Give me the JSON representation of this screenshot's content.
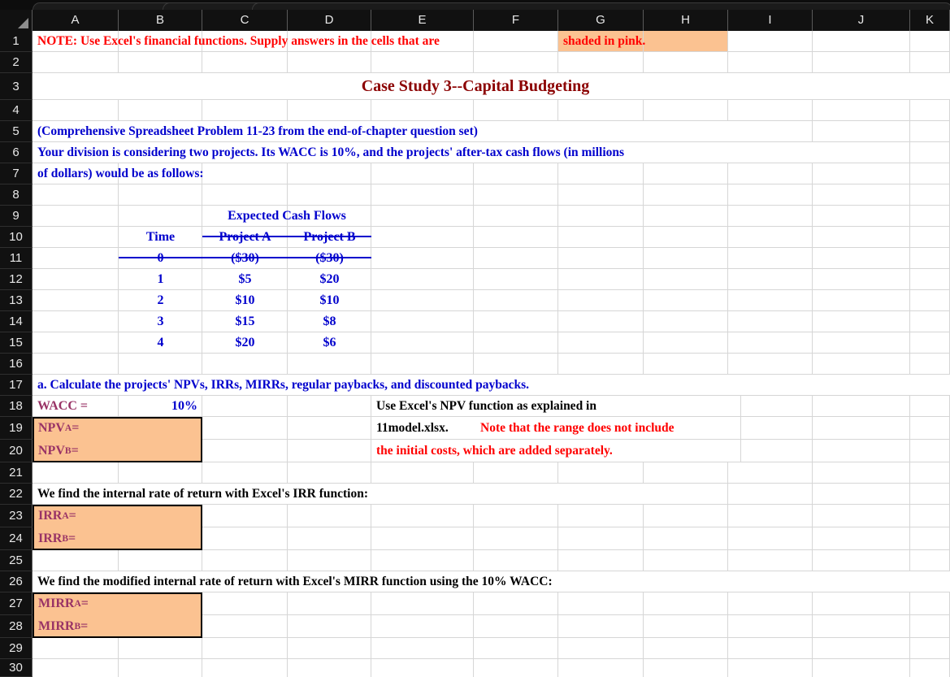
{
  "window": {
    "tabs": [
      "tab-1",
      "tab-2",
      "tab-3"
    ]
  },
  "spreadsheet": {
    "column_headers": [
      "A",
      "B",
      "C",
      "D",
      "E",
      "F",
      "G",
      "H",
      "I",
      "J",
      "K"
    ],
    "row_numbers": [
      "1",
      "2",
      "3",
      "4",
      "5",
      "6",
      "7",
      "8",
      "9",
      "10",
      "11",
      "12",
      "13",
      "14",
      "15",
      "16",
      "17",
      "18",
      "19",
      "20",
      "21",
      "22",
      "23",
      "24",
      "25",
      "26",
      "27",
      "28",
      "29",
      "30"
    ],
    "colors": {
      "note_text": "#ff0000",
      "title_text": "#8b0000",
      "body_text": "#0000cd",
      "label_text": "#993366",
      "pink_fill": "#fbc291",
      "header_bg": "#111111",
      "gridline": "#d6d6d6"
    },
    "cells": {
      "note": "NOTE:  Use Excel's financial functions.  Supply answers in the cells that are ",
      "note_highlight": "shaded in pink.",
      "title": "Case Study 3--Capital Budgeting",
      "intro_line1": "(Comprehensive Spreadsheet Problem 11-23 from the end-of-chapter question set)",
      "intro_line2": "Your division is considering two projects.  Its WACC is 10%, and the projects' after-tax cash flows (in millions",
      "intro_line3": "of dollars) would be as follows:",
      "cashflow_header": "Expected Cash Flows",
      "col_time": "Time",
      "col_project_a": "Project A",
      "col_project_b": "Project B",
      "question_a": "a.   Calculate the projects' NPVs, IRRs, MIRRs, regular paybacks, and discounted paybacks.",
      "wacc_label": "WACC  =",
      "wacc_value": "10%",
      "npv_a_label": "NPV",
      "npv_a_sub": "A",
      "npv_b_label": "NPV",
      "npv_b_sub": "B",
      "eq": " =",
      "npv_note_line1": "Use Excel's NPV function as explained in",
      "npv_note_line2_black": "11model.xlsx.  ",
      "npv_note_line2_red": "Note that the range does not include",
      "npv_note_line3_red": "the initial costs, which are added separately.",
      "irr_heading": "We find the internal rate of return with Excel's  IRR function:",
      "irr_a_label": "IRR",
      "irr_a_sub": "A",
      "irr_b_label": "IRR",
      "irr_b_sub": "B",
      "mirr_heading": "We find the modified internal rate of return with Excel's  MIRR function using the 10% WACC:",
      "mirr_a_label": "MIRR",
      "mirr_a_sub": "A",
      "mirr_b_label": "MIRR",
      "mirr_b_sub": "B"
    },
    "cashflow_table": {
      "columns": [
        "Time",
        "Project A",
        "Project B"
      ],
      "rows": [
        {
          "time": "0",
          "project_a": "($30)",
          "project_b": "($30)"
        },
        {
          "time": "1",
          "project_a": "$5",
          "project_b": "$20"
        },
        {
          "time": "2",
          "project_a": "$10",
          "project_b": "$10"
        },
        {
          "time": "3",
          "project_a": "$15",
          "project_b": "$8"
        },
        {
          "time": "4",
          "project_a": "$20",
          "project_b": "$6"
        }
      ]
    },
    "answer_cells": {
      "npv_a": "",
      "npv_b": "",
      "irr_a": "",
      "irr_b": "",
      "mirr_a": "",
      "mirr_b": ""
    }
  }
}
